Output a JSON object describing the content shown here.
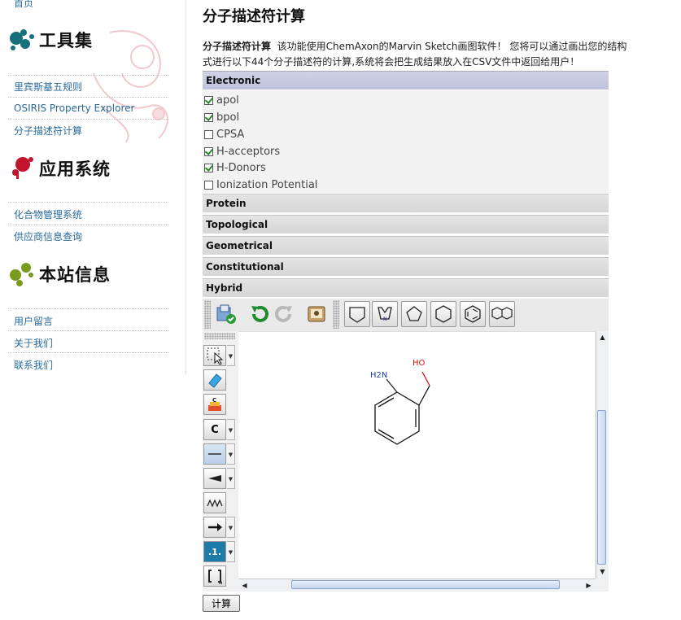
{
  "sidebar": {
    "top_link": "首页",
    "sections": [
      {
        "title": "工具集",
        "color": "#16707c",
        "links": [
          "里宾斯基五规则",
          "OSIRIS Property Explorer",
          "分子描述符计算"
        ]
      },
      {
        "title": "应用系统",
        "color": "#c2142c",
        "links": [
          "化合物管理系统",
          "供应商信息查询"
        ]
      },
      {
        "title": "本站信息",
        "color": "#7a9a1e",
        "links": [
          "用户留言",
          "关于我们",
          "联系我们"
        ]
      }
    ]
  },
  "main": {
    "title": "分子描述符计算",
    "intro_label": "分子描述符计算",
    "intro_line1": "该功能使用ChemAxon的Marvin  Sketch画图软件！  您将可以通过画出您的结构",
    "intro_line2": "式进行以下44个分子描述符的计算,系统将会把生成结果放入在CSV文件中返回给用户！",
    "categories": [
      "Electronic",
      "Protein",
      "Topological",
      "Geometrical",
      "Constitutional",
      "Hybrid"
    ],
    "electronic_options": [
      {
        "label": "apol",
        "checked": true
      },
      {
        "label": "bpol",
        "checked": true
      },
      {
        "label": "CPSA",
        "checked": false
      },
      {
        "label": "H-acceptors",
        "checked": true
      },
      {
        "label": "H-Donors",
        "checked": true
      },
      {
        "label": "Ionization Potential",
        "checked": false
      }
    ],
    "submit_label": "计算"
  },
  "sketcher": {
    "left_tools": {
      "atom_label": "C",
      "number_label": ".1."
    },
    "molecule": {
      "atom_NH2": "H2N",
      "atom_OH": "HO"
    }
  },
  "colors": {
    "link": "#2a6a9c",
    "accent_header": "#c4c8e0"
  }
}
